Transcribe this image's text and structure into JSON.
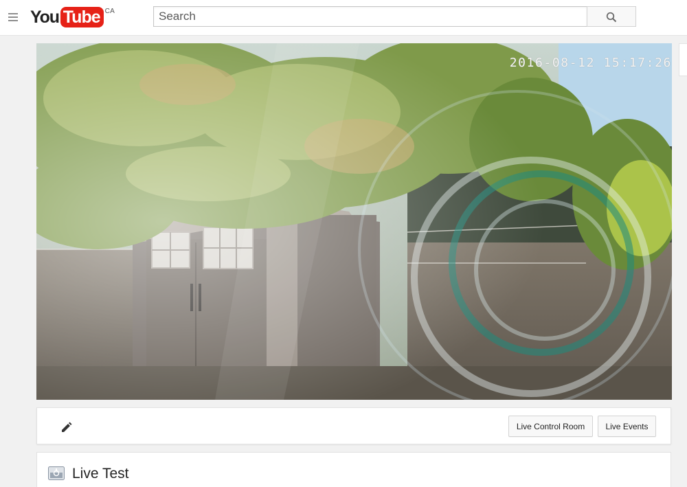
{
  "masthead": {
    "logo_you": "You",
    "logo_tube": "Tube",
    "country_code": "CA",
    "search_placeholder": "Search"
  },
  "video": {
    "timestamp": "2016-08-12 15:17:26"
  },
  "toolbar": {
    "live_control_room_label": "Live Control Room",
    "live_events_label": "Live Events"
  },
  "stream": {
    "title": "Live Test"
  },
  "colors": {
    "brand_red": "#e62117",
    "page_bg": "#f1f1f1"
  },
  "icons": [
    "menu-icon",
    "search-icon",
    "pencil-icon",
    "live-stream-icon"
  ]
}
